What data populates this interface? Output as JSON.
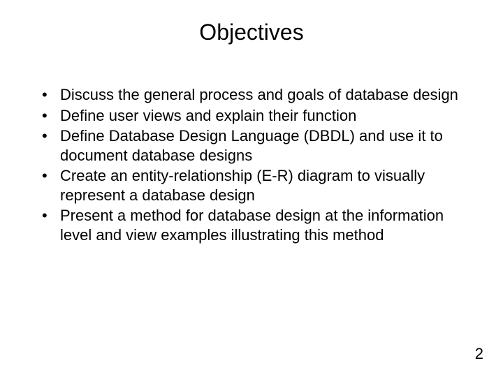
{
  "title": "Objectives",
  "bullets": [
    "Discuss the general process and goals of database design",
    "Define user views and explain their function",
    "Define Database Design Language (DBDL) and use it to document database designs",
    "Create an entity-relationship (E-R) diagram to visually represent a database design",
    "Present a method for database design at the information level and view examples illustrating this method"
  ],
  "page_number": "2"
}
